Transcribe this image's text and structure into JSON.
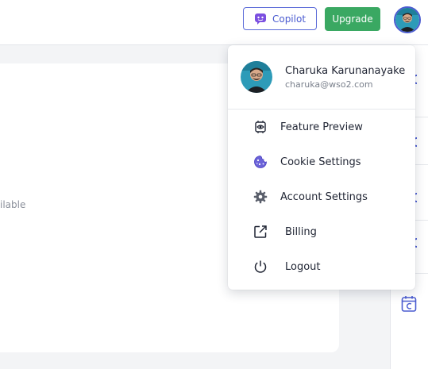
{
  "header": {
    "copilot_label": "Copilot",
    "upgrade_label": "Upgrade"
  },
  "content": {
    "partial_text": "ilable"
  },
  "user_menu": {
    "name": "Charuka Karunanayake",
    "email": "charuka@wso2.com",
    "items": [
      {
        "label": "Feature Preview",
        "icon": "feature-preview-icon"
      },
      {
        "label": "Cookie Settings",
        "icon": "cookie-icon"
      },
      {
        "label": "Account Settings",
        "icon": "gear-icon"
      },
      {
        "label": "Billing",
        "icon": "external-link-icon"
      },
      {
        "label": "Logout",
        "icon": "power-icon"
      }
    ]
  },
  "colors": {
    "accent": "#4a5bd0",
    "upgrade": "#3aa862",
    "copilot_badge": "#7b4fe0"
  }
}
